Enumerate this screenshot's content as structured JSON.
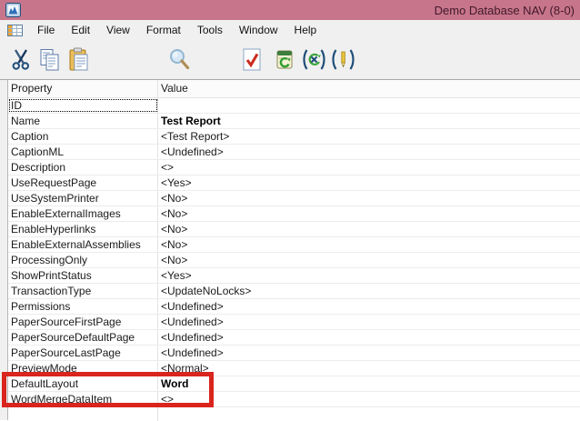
{
  "window": {
    "title": "Demo Database NAV (8-0)"
  },
  "menu": {
    "items": [
      "File",
      "Edit",
      "View",
      "Format",
      "Tools",
      "Window",
      "Help"
    ]
  },
  "toolbar": {
    "icons": [
      "cut",
      "copy",
      "paste",
      "find",
      "check-document",
      "import-data",
      "symbol-menu",
      "locals"
    ]
  },
  "table": {
    "columns": [
      "Property",
      "Value"
    ],
    "rows": [
      {
        "property": "ID",
        "value": "",
        "focused": true
      },
      {
        "property": "Name",
        "value": "Test Report",
        "bold": true
      },
      {
        "property": "Caption",
        "value": "<Test Report>"
      },
      {
        "property": "CaptionML",
        "value": "<Undefined>"
      },
      {
        "property": "Description",
        "value": "<>"
      },
      {
        "property": "UseRequestPage",
        "value": "<Yes>"
      },
      {
        "property": "UseSystemPrinter",
        "value": "<No>"
      },
      {
        "property": "EnableExternalImages",
        "value": "<No>"
      },
      {
        "property": "EnableHyperlinks",
        "value": "<No>"
      },
      {
        "property": "EnableExternalAssemblies",
        "value": "<No>"
      },
      {
        "property": "ProcessingOnly",
        "value": "<No>"
      },
      {
        "property": "ShowPrintStatus",
        "value": "<Yes>"
      },
      {
        "property": "TransactionType",
        "value": "<UpdateNoLocks>"
      },
      {
        "property": "Permissions",
        "value": "<Undefined>"
      },
      {
        "property": "PaperSourceFirstPage",
        "value": "<Undefined>"
      },
      {
        "property": "PaperSourceDefaultPage",
        "value": "<Undefined>"
      },
      {
        "property": "PaperSourceLastPage",
        "value": "<Undefined>"
      },
      {
        "property": "PreviewMode",
        "value": "<Normal>"
      },
      {
        "property": "DefaultLayout",
        "value": "Word",
        "bold": true,
        "annotated": true
      },
      {
        "property": "WordMergeDataItem",
        "value": "<>"
      }
    ]
  },
  "colors": {
    "titlebar": "#c7758b",
    "titlebar_text": "#42192b",
    "annotation": "#d9251d",
    "chrome": "#f0f0f0"
  }
}
